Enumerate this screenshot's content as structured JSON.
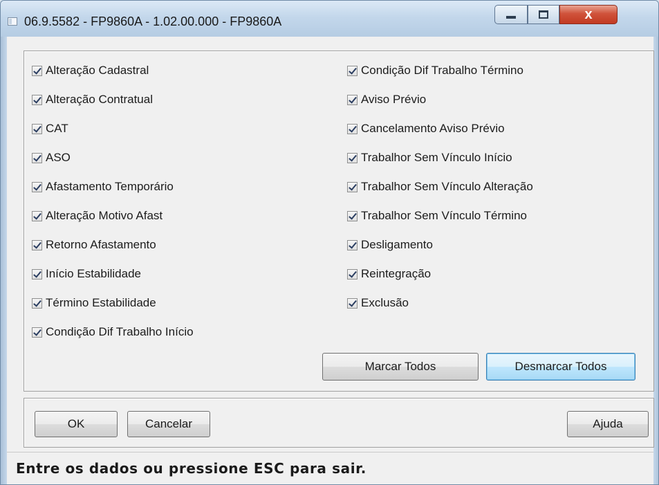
{
  "window": {
    "title": "06.9.5582 - FP9860A - 1.02.00.000 - FP9860A",
    "icons": {
      "app": "app-window-icon",
      "minimize": "minimize-icon",
      "maximize": "maximize-icon",
      "close": "close-icon"
    },
    "close_glyph": "x"
  },
  "options": {
    "left": [
      {
        "label": "Alteração Cadastral",
        "checked": true
      },
      {
        "label": "Alteração Contratual",
        "checked": true
      },
      {
        "label": "CAT",
        "checked": true
      },
      {
        "label": "ASO",
        "checked": true
      },
      {
        "label": "Afastamento Temporário",
        "checked": true
      },
      {
        "label": "Alteração Motivo Afast",
        "checked": true
      },
      {
        "label": "Retorno Afastamento",
        "checked": true
      },
      {
        "label": "Início Estabilidade",
        "checked": true
      },
      {
        "label": "Término Estabilidade",
        "checked": true
      },
      {
        "label": "Condição Dif Trabalho Início",
        "checked": true
      }
    ],
    "right": [
      {
        "label": "Condição Dif Trabalho Término",
        "checked": true
      },
      {
        "label": "Aviso Prévio",
        "checked": true
      },
      {
        "label": "Cancelamento Aviso Prévio",
        "checked": true
      },
      {
        "label": "Trabalhor Sem Vínculo Início",
        "checked": true
      },
      {
        "label": "Trabalhor Sem Vínculo Alteração",
        "checked": true
      },
      {
        "label": "Trabalhor Sem Vínculo Término",
        "checked": true
      },
      {
        "label": "Desligamento",
        "checked": true
      },
      {
        "label": "Reintegração",
        "checked": true
      },
      {
        "label": "Exclusão",
        "checked": true
      }
    ]
  },
  "actions": {
    "select_all": "Marcar Todos",
    "deselect_all": "Desmarcar Todos"
  },
  "footer": {
    "ok": "OK",
    "cancel": "Cancelar",
    "help": "Ajuda"
  },
  "status": {
    "message": "Entre os dados ou pressione ESC para sair."
  },
  "colors": {
    "titlebar": "#c3d7eb",
    "close_button": "#c23a22",
    "dialog_bg": "#f0f0f0",
    "default_button": "#bee6fd"
  }
}
